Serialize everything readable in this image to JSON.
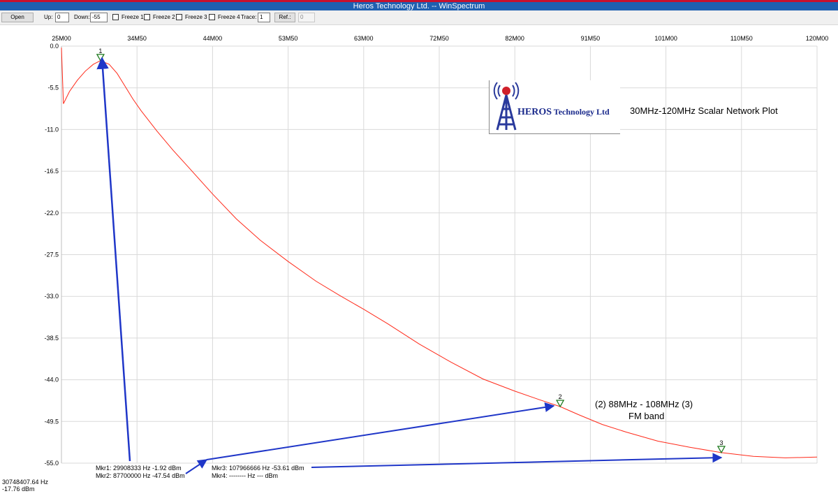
{
  "window": {
    "title": "Heros Technology Ltd.  --  WinSpectrum"
  },
  "toolbar": {
    "open_label": "Open",
    "up_label": "Up:",
    "up_value": "0",
    "down_label": "Down:",
    "down_value": "-55",
    "freeze1_label": "Freeze 1",
    "freeze2_label": "Freeze 2",
    "freeze3_label": "Freeze 3",
    "freeze4_label": "Freeze 4",
    "trace_label": "Trace:",
    "trace_value": "1",
    "ref_label": "Ref.:",
    "ref_value": "0"
  },
  "logo": {
    "name_bold": "HEROS",
    "name_rest": " Technology Ltd",
    "icon": "antenna-tower-icon"
  },
  "annotations": {
    "plot_title": "30MHz-120MHz Scalar Network Plot",
    "fm_line1": "(2) 88MHz - 108MHz (3)",
    "fm_line2": "FM band"
  },
  "markers_readout": {
    "mkr1": "Mkr1: 29908333 Hz -1.92 dBm",
    "mkr2": "Mkr2: 87700000 Hz -47.54 dBm",
    "mkr3": "Mkr3: 107966666 Hz -53.61 dBm",
    "mkr4": "Mkr4: -------- Hz    --- dBm"
  },
  "cursor_readout": {
    "freq": "30748407.64 Hz",
    "level": "-17.76 dBm"
  },
  "colors": {
    "trace": "#ff2a1a",
    "grid": "#d9d9d9",
    "marker": "#1e7a1e",
    "arrow": "#1f36c8"
  },
  "chart_data": {
    "type": "line",
    "xlim": [
      25000000,
      120000000
    ],
    "ylim": [
      -55,
      0
    ],
    "x_tick_values": [
      25000000,
      34500000,
      44000000,
      53500000,
      63000000,
      72500000,
      82000000,
      91500000,
      101000000,
      110500000,
      120000000
    ],
    "x_tick_labels": [
      "25M00",
      "34M50",
      "44M00",
      "53M50",
      "63M00",
      "72M50",
      "82M00",
      "91M50",
      "101M00",
      "110M50",
      "120M00"
    ],
    "y_tick_values": [
      0,
      -5.5,
      -11,
      -16.5,
      -22,
      -27.5,
      -33,
      -38.5,
      -44,
      -49.5,
      -55
    ],
    "y_tick_labels": [
      "0.0",
      "-5.5",
      "-11.0",
      "-16.5",
      "-22.0",
      "-27.5",
      "-33.0",
      "-38.5",
      "-44.0",
      "-49.5",
      "-55.0"
    ],
    "grid": true,
    "series": [
      {
        "x": [
          25000000,
          25250000,
          26000000,
          27000000,
          28000000,
          29000000,
          29908333,
          31000000,
          32000000,
          33000000,
          34000000,
          35000000,
          37000000,
          39000000,
          41000000,
          44000000,
          47000000,
          50000000,
          53500000,
          57000000,
          60000000,
          63000000,
          66000000,
          70000000,
          74000000,
          78000000,
          82000000,
          85000000,
          87700000,
          90000000,
          93000000,
          96000000,
          100000000,
          104000000,
          107966666,
          112000000,
          116000000,
          120000000
        ],
        "y": [
          -0.2,
          -7.6,
          -6.0,
          -4.5,
          -3.3,
          -2.4,
          -1.92,
          -2.4,
          -3.6,
          -5.3,
          -7.0,
          -8.5,
          -11.2,
          -13.7,
          -16.0,
          -19.5,
          -22.8,
          -25.6,
          -28.4,
          -31.0,
          -32.9,
          -34.7,
          -36.6,
          -39.3,
          -41.7,
          -43.9,
          -45.5,
          -46.6,
          -47.54,
          -48.6,
          -49.9,
          -50.9,
          -52.1,
          -52.9,
          -53.61,
          -54.1,
          -54.3,
          -54.2
        ]
      }
    ],
    "markers": [
      {
        "label": "1",
        "x": 29908333,
        "y": -1.92
      },
      {
        "label": "2",
        "x": 87700000,
        "y": -47.54
      },
      {
        "label": "3",
        "x": 107966666,
        "y": -53.61
      }
    ]
  }
}
